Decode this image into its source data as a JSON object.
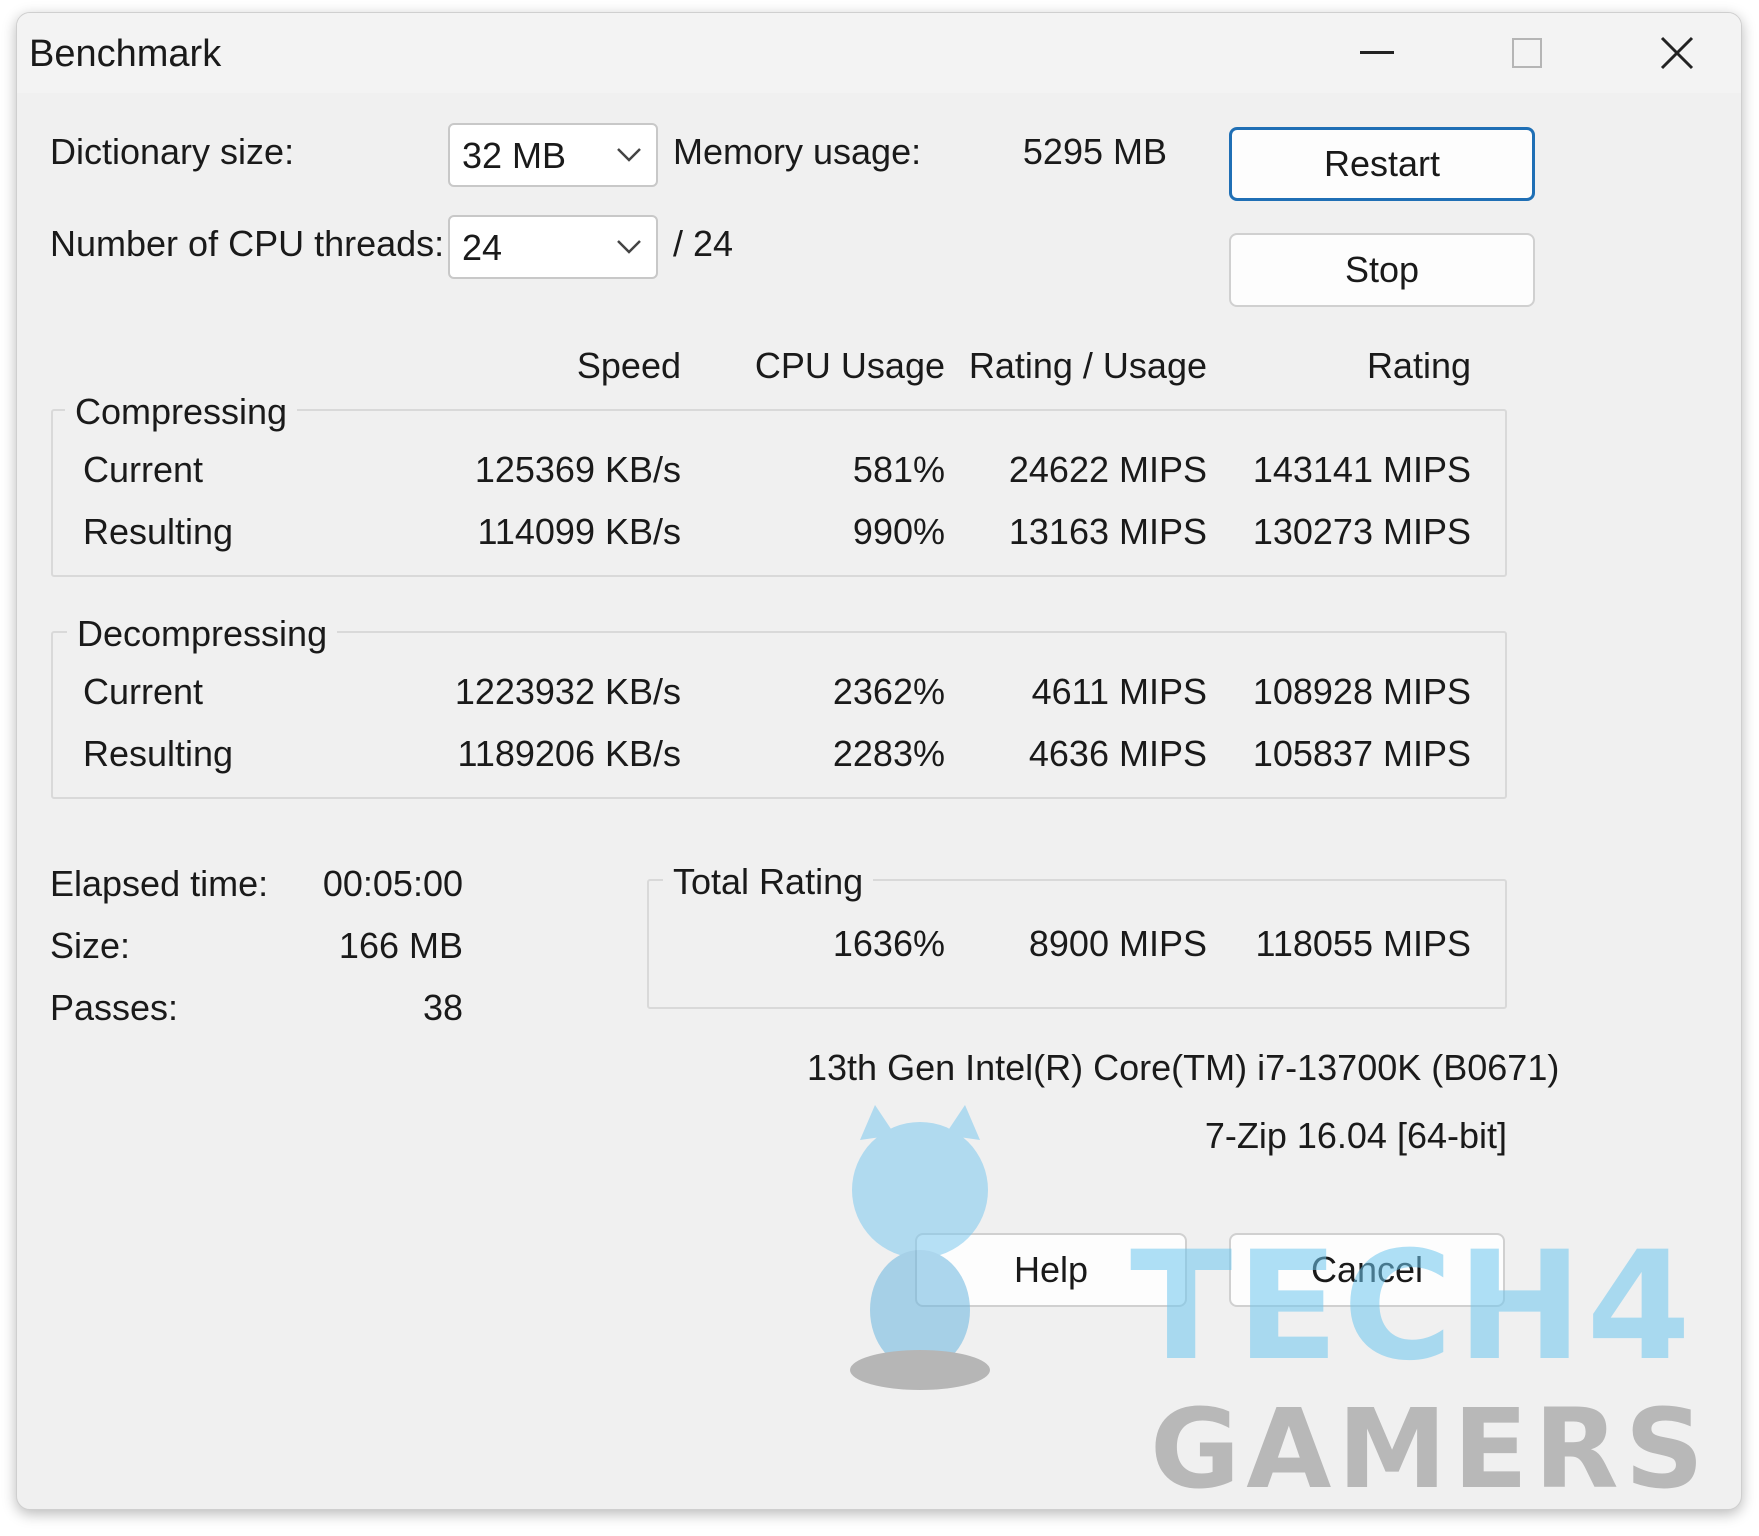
{
  "window": {
    "title": "Benchmark",
    "controls": {
      "minimize": "minimize-icon",
      "maximize": "maximize-icon",
      "close": "close-icon"
    }
  },
  "settings": {
    "dictionary_label": "Dictionary size:",
    "dictionary_value": "32 MB",
    "memory_label": "Memory usage:",
    "memory_value": "5295 MB",
    "threads_label": "Number of CPU threads:",
    "threads_value": "24",
    "threads_total": "/ 24"
  },
  "buttons": {
    "restart": "Restart",
    "stop": "Stop",
    "help": "Help",
    "cancel": "Cancel"
  },
  "columns": {
    "speed": "Speed",
    "cpu_usage": "CPU Usage",
    "rating_usage": "Rating / Usage",
    "rating": "Rating"
  },
  "compressing": {
    "title": "Compressing",
    "rows": [
      {
        "label": "Current",
        "speed": "125369 KB/s",
        "cpu": "581%",
        "rating_usage": "24622 MIPS",
        "rating": "143141 MIPS"
      },
      {
        "label": "Resulting",
        "speed": "114099 KB/s",
        "cpu": "990%",
        "rating_usage": "13163 MIPS",
        "rating": "130273 MIPS"
      }
    ]
  },
  "decompressing": {
    "title": "Decompressing",
    "rows": [
      {
        "label": "Current",
        "speed": "1223932 KB/s",
        "cpu": "2362%",
        "rating_usage": "4611 MIPS",
        "rating": "108928 MIPS"
      },
      {
        "label": "Resulting",
        "speed": "1189206 KB/s",
        "cpu": "2283%",
        "rating_usage": "4636 MIPS",
        "rating": "105837 MIPS"
      }
    ]
  },
  "stats": {
    "elapsed_label": "Elapsed time:",
    "elapsed_value": "00:05:00",
    "size_label": "Size:",
    "size_value": "166 MB",
    "passes_label": "Passes:",
    "passes_value": "38"
  },
  "total": {
    "title": "Total Rating",
    "cpu": "1636%",
    "rating_usage": "8900 MIPS",
    "rating": "118055 MIPS"
  },
  "system": {
    "cpu_name": "13th Gen Intel(R) Core(TM) i7-13700K (B0671)",
    "version": "7-Zip 16.04 [64-bit]"
  },
  "watermark": {
    "line1": "TECH4",
    "line2": "GAMERS"
  },
  "colors": {
    "window_bg": "#f0f0f0",
    "accent": "#1f6fb5"
  }
}
